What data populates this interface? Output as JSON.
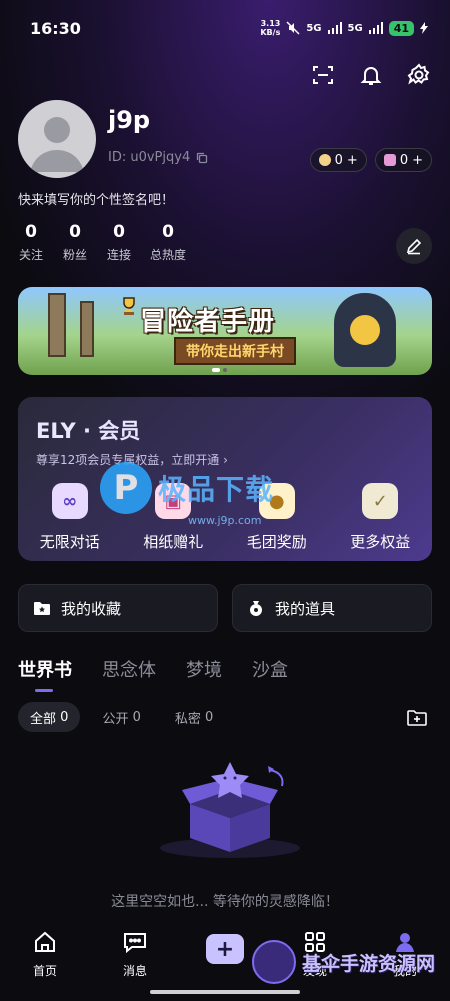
{
  "status": {
    "time": "16:30",
    "net_speed_top": "3.13",
    "net_speed_bottom": "KB/s",
    "signal1": "5G",
    "signal2": "5G",
    "battery": "41"
  },
  "profile": {
    "username": "j9p",
    "user_id": "ID: u0vPjqy4",
    "coin_a": "0",
    "coin_b": "0",
    "bio": "快来填写你的个性签名吧！"
  },
  "stats": [
    {
      "value": "0",
      "label": "关注"
    },
    {
      "value": "0",
      "label": "粉丝"
    },
    {
      "value": "0",
      "label": "连接"
    },
    {
      "value": "0",
      "label": "总热度"
    }
  ],
  "banner": {
    "title": "冒险者手册",
    "subtitle": "带你走出新手村"
  },
  "vip": {
    "title": "ELY · 会员",
    "subtitle": "尊享12项会员专属权益，立即开通 ›",
    "perks": [
      {
        "label": "无限对话",
        "icon": "infinity-icon"
      },
      {
        "label": "相纸赠礼",
        "icon": "photo-gift-icon"
      },
      {
        "label": "毛团奖励",
        "icon": "fluff-reward-icon"
      },
      {
        "label": "更多权益",
        "icon": "medal-icon"
      }
    ]
  },
  "watermark": {
    "text": "极品下载",
    "url": "www.j9p.com"
  },
  "quick": {
    "favorites": "我的收藏",
    "items": "我的道具"
  },
  "tabs": [
    "世界书",
    "思念体",
    "梦境",
    "沙盒"
  ],
  "filters": [
    {
      "label": "全部",
      "count": "0"
    },
    {
      "label": "公开",
      "count": "0"
    },
    {
      "label": "私密",
      "count": "0"
    }
  ],
  "empty_text": "这里空空如也... 等待你的灵感降临！",
  "nav": {
    "home": "首页",
    "messages": "消息",
    "discover": "发现",
    "me": "我的"
  },
  "corner_watermark": "基伞手游资源网",
  "colors": {
    "accent": "#7b6cf0",
    "background": "#0b0b10",
    "card": "#1a1a22"
  }
}
